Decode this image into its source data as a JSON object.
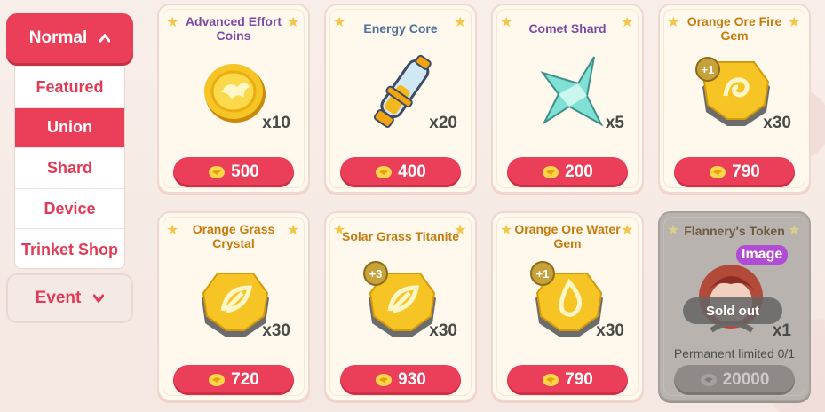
{
  "sidebar": {
    "category_normal": "Normal",
    "category_event": "Event",
    "items": [
      {
        "label": "Featured"
      },
      {
        "label": "Union"
      },
      {
        "label": "Shard"
      },
      {
        "label": "Device"
      },
      {
        "label": "Trinket Shop"
      }
    ]
  },
  "colors": {
    "accent": "#ea3e59",
    "card_bg": "#fff8ec",
    "sold_bg": "#b9b3af"
  },
  "cards": [
    {
      "title": "Advanced Effort Coins",
      "qty": "x10",
      "price": "500",
      "icon": "gold-coin-icon"
    },
    {
      "title": "Energy Core",
      "qty": "x20",
      "price": "400",
      "icon": "energy-core-icon"
    },
    {
      "title": "Comet Shard",
      "qty": "x5",
      "price": "200",
      "icon": "comet-shard-icon"
    },
    {
      "title": "Orange Ore Fire Gem",
      "qty": "x30",
      "price": "790",
      "badge": "+1",
      "icon": "fire-gem-icon"
    },
    {
      "title": "Orange Grass Crystal",
      "qty": "x30",
      "price": "720",
      "icon": "grass-crystal-icon"
    },
    {
      "title": "Solar Grass Titanite",
      "qty": "x30",
      "price": "930",
      "badge": "+3",
      "icon": "grass-titanite-icon"
    },
    {
      "title": "Orange Ore Water Gem",
      "qty": "x30",
      "price": "790",
      "badge": "+1",
      "icon": "water-gem-icon"
    },
    {
      "title": "Flannery's Token",
      "qty": "x1",
      "price": "20000",
      "image_tag": "Image",
      "sold_out": "Sold out",
      "limit": "Permanent limited 0/1",
      "icon": "token-portrait-icon"
    }
  ]
}
